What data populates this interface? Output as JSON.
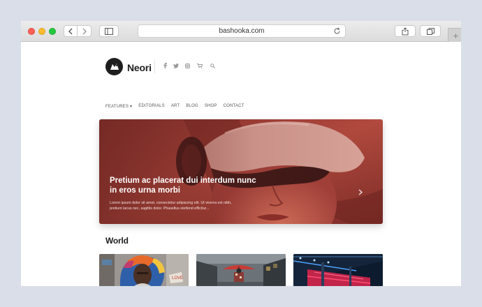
{
  "browser": {
    "url": "bashooka.com",
    "new_tab_symbol": "+"
  },
  "site": {
    "logo_text": "Neori",
    "social_icons": [
      "facebook-icon",
      "twitter-icon",
      "instagram-icon",
      "cart-icon",
      "search-icon"
    ],
    "nav": [
      {
        "label": "FEATURES ▾"
      },
      {
        "label": "EDITORIALS"
      },
      {
        "label": "ART"
      },
      {
        "label": "BLOG"
      },
      {
        "label": "SHOP"
      },
      {
        "label": "CONTACT"
      }
    ]
  },
  "hero": {
    "title": "Pretium ac placerat dui interdum nunc in eros urna morbi",
    "excerpt": "Lorem ipsum dolor sit amet, consectetur adipiscing elit. Ut viverra est nibh, pretium lacus nec, sagittis dolor. Phasellus eleifend efficitur...",
    "arrow": "›"
  },
  "section": {
    "title": "World"
  },
  "colors": {
    "hero_tint": "#b0433a",
    "accent_dark": "#1e1e1e"
  }
}
